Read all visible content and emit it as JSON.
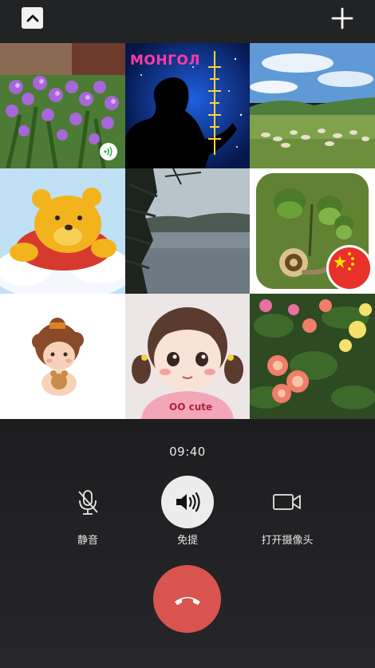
{
  "topbar": {
    "collapse_icon": "chevron-up-icon",
    "add_icon": "plus-icon"
  },
  "participants": [
    {
      "avatar": "purple-orchids",
      "badge_icon": "speaking-icon",
      "speaking": true
    },
    {
      "avatar": "silhouette-with-mongolian-script",
      "text": "MOHГOЛ"
    },
    {
      "avatar": "grassland-sheep"
    },
    {
      "avatar": "winnie-the-pooh"
    },
    {
      "avatar": "lake-view"
    },
    {
      "avatar": "acorns-and-snail",
      "badge_icon": "china-flag-icon"
    },
    {
      "avatar": "cartoon-curly-hair-kid"
    },
    {
      "avatar": "cartoon-girl-pigtails",
      "shirt_text": "OO cute"
    },
    {
      "avatar": "begonia-flowers"
    }
  ],
  "call": {
    "duration": "09:40",
    "mute": {
      "label": "静音",
      "icon": "microphone-icon",
      "active": false
    },
    "speaker": {
      "label": "免提",
      "icon": "speaker-icon",
      "active": true
    },
    "camera": {
      "label": "打开摄像头",
      "icon": "video-camera-icon",
      "active": false
    },
    "hangup": {
      "icon": "hang-up-icon",
      "color": "#d9534f"
    }
  },
  "colors": {
    "background": "#1c1c1e",
    "topbar": "#222325",
    "hangup": "#d9534f",
    "active_button": "#ececec"
  }
}
